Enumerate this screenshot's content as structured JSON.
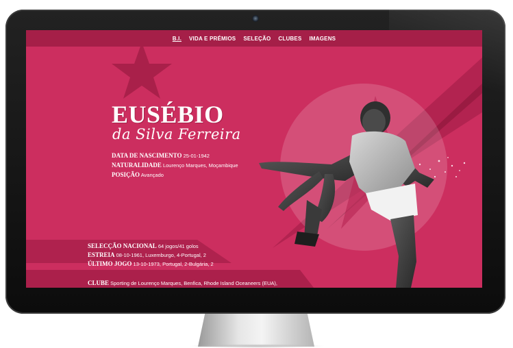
{
  "nav": {
    "items": [
      {
        "label": "B.I.",
        "active": true
      },
      {
        "label": "VIDA E PRÉMIOS"
      },
      {
        "label": "SELEÇÃO"
      },
      {
        "label": "CLUBES"
      },
      {
        "label": "IMAGENS"
      }
    ]
  },
  "hero": {
    "name": "EUSÉBIO",
    "fullname": "da Silva Ferreira"
  },
  "bio": {
    "birth_label": "DATA DE NASCIMENTO",
    "birth_value": "25-01-1942",
    "birthplace_label": "NATURALIDADE",
    "birthplace_value": "Lourenço Marques, Moçambique",
    "position_label": "POSIÇÃO",
    "position_value": "Avançado"
  },
  "career": {
    "national_label": "SELECÇÃO NACIONAL",
    "national_value": "64 jogos/41 golos",
    "debut_label": "ESTREIA",
    "debut_value": "08-10-1961, Luxemburgo, 4-Portugal, 2",
    "last_label": "ÚLTIMO JOGO",
    "last_value": "13-10-1973, Portugal, 2-Bulgária, 2",
    "club_label": "CLUBE",
    "club_value": "Sporting de Lourenço Marques, Benfica, Rhode Island Oceaneers (EUA),"
  },
  "colors": {
    "screen_bg": "#cc2e5f",
    "nav_bg": "#a51f48",
    "accent_dark": "#9c1b43"
  }
}
